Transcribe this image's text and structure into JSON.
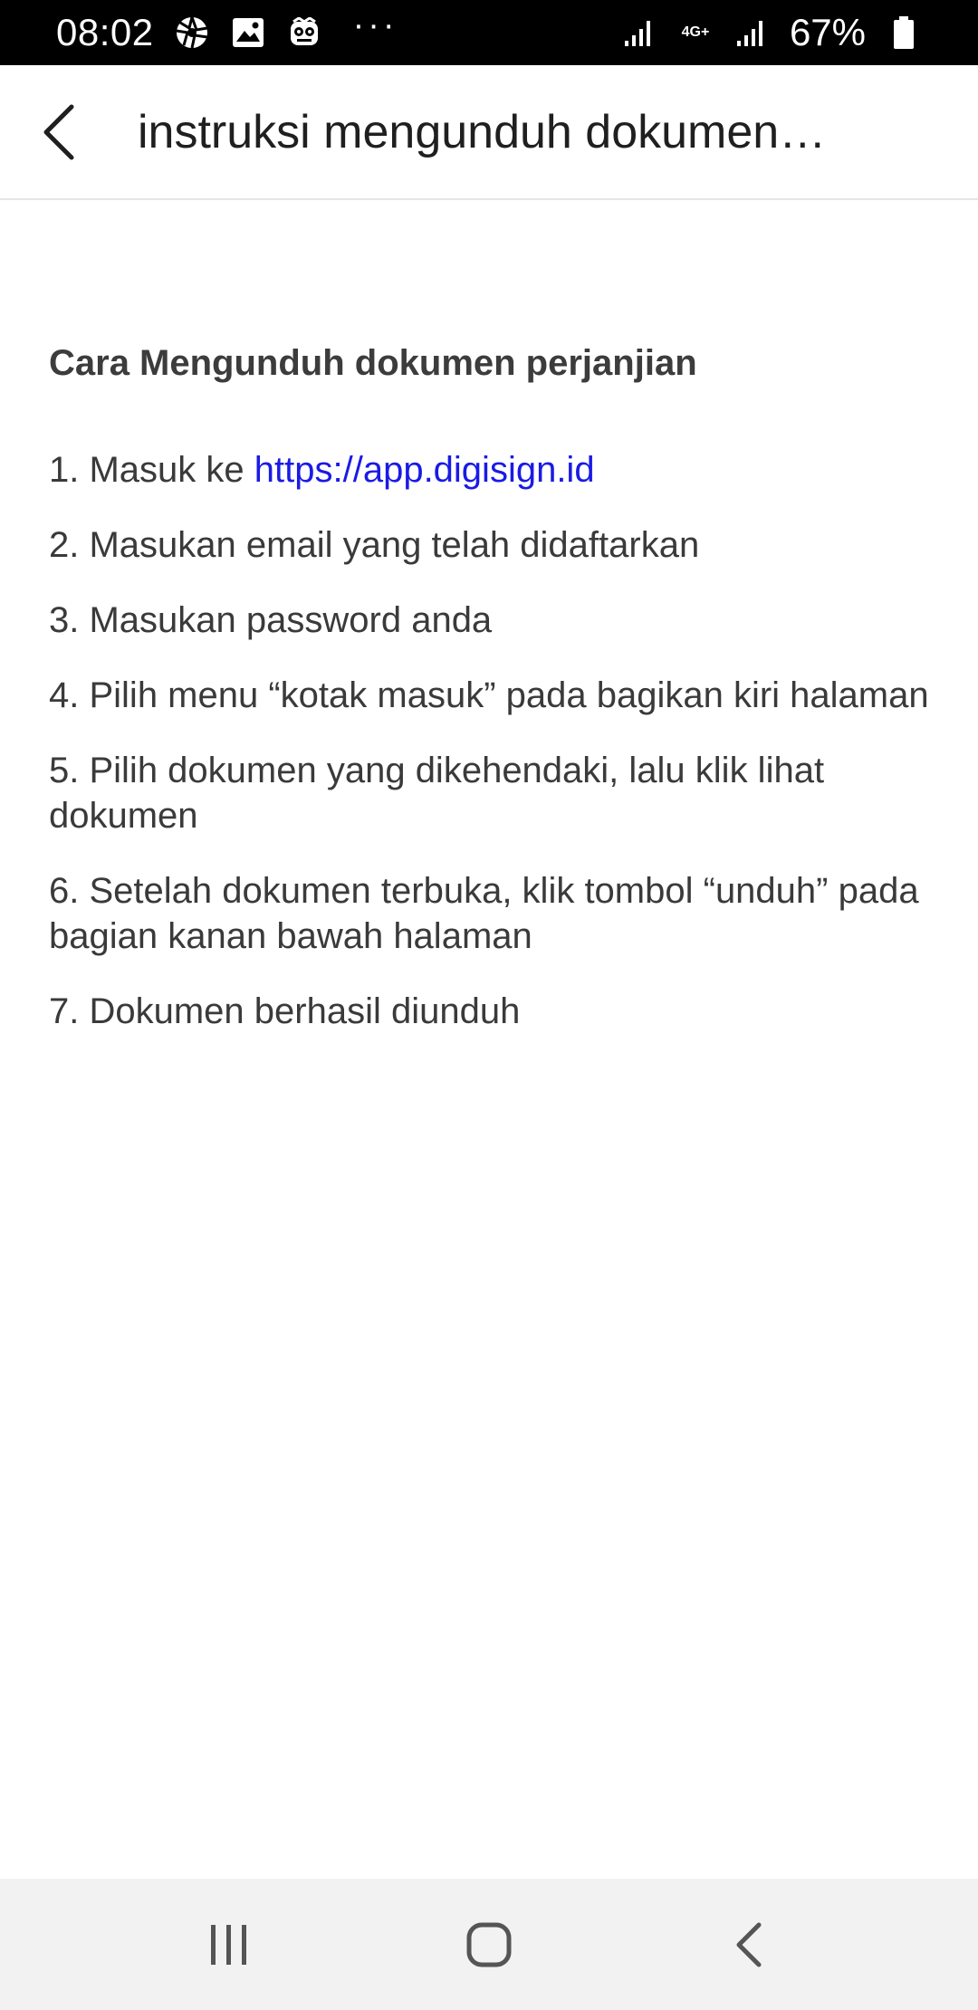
{
  "status_bar": {
    "time": "08:02",
    "battery_percent": "67%",
    "network_type": "4G+",
    "icons": [
      "aperture-icon",
      "image-icon",
      "owl-icon",
      "more-dots-icon",
      "signal-icon",
      "signal-icon",
      "battery-icon"
    ]
  },
  "header": {
    "title": "instruksi mengunduh dokumen…"
  },
  "content": {
    "heading": "Cara Mengunduh dokumen perjanjian",
    "step1_prefix": "1. Masuk ke ",
    "step1_link": "https://app.digisign.id",
    "steps": [
      "2. Masukan email yang telah didaftarkan",
      "3. Masukan password anda",
      "4. Pilih menu “kotak masuk” pada bagikan kiri halaman",
      "5. Pilih dokumen yang dikehendaki, lalu klik lihat dokumen",
      "6. Setelah dokumen terbuka, klik tombol “unduh” pada bagian kanan bawah halaman",
      "7. Dokumen berhasil diunduh"
    ]
  },
  "colors": {
    "link": "#1a1ae6",
    "text": "#3a3a3a",
    "status_bar": "#000000",
    "nav_bar": "#f2f2f2"
  }
}
